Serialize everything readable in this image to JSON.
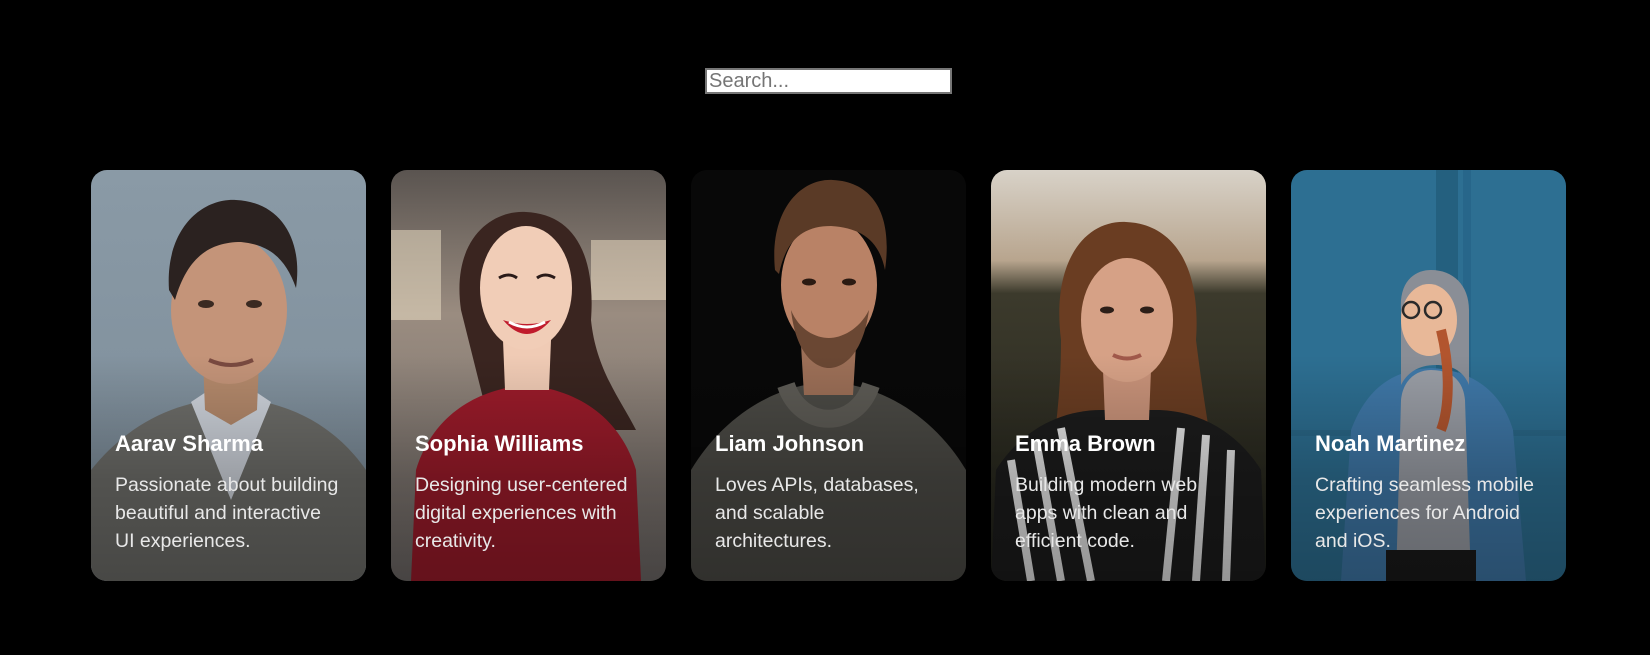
{
  "search": {
    "placeholder": "Search..."
  },
  "cards": [
    {
      "name": "Aarav Sharma",
      "bio": "Passionate about building beautiful and interactive UI experiences."
    },
    {
      "name": "Sophia Williams",
      "bio": "Designing user-centered digital experiences with creativity."
    },
    {
      "name": "Liam Johnson",
      "bio": "Loves APIs, databases, and scalable architectures."
    },
    {
      "name": "Emma Brown",
      "bio": "Building modern web apps with clean and efficient code."
    },
    {
      "name": "Noah Martinez",
      "bio": "Crafting seamless mobile experiences for Android and iOS."
    }
  ]
}
